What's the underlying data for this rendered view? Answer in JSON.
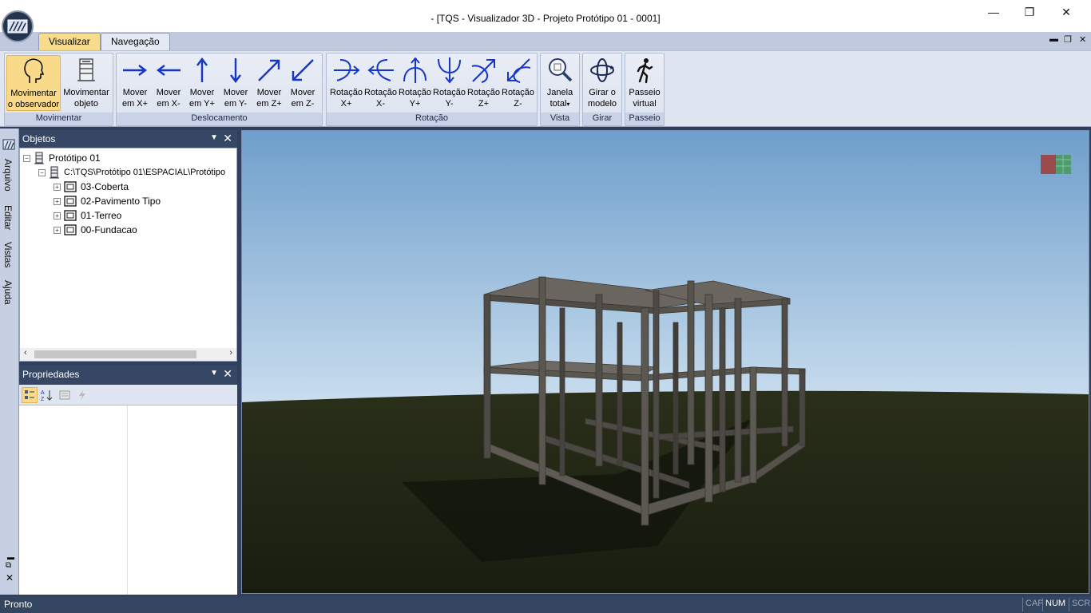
{
  "window": {
    "title": "- [TQS - Visualizador 3D - Projeto Protótipo 01 - 0001]",
    "minimize": "—",
    "maximize": "❐",
    "close": "✕"
  },
  "tabs": [
    {
      "label": "Visualizar",
      "active": true
    },
    {
      "label": "Navegação",
      "active": false
    }
  ],
  "mdi_controls": {
    "minimize": "▬",
    "restore": "❐",
    "close": "✕"
  },
  "ribbon": {
    "groups": [
      {
        "label": "Movimentar"
      },
      {
        "label": "Deslocamento"
      },
      {
        "label": "Rotação"
      },
      {
        "label": "Vista"
      },
      {
        "label": "Girar"
      },
      {
        "label": "Passeio"
      }
    ],
    "buttons": {
      "movimentar_observador": {
        "line1": "Movimentar",
        "line2": "o observador",
        "icon": "head-icon"
      },
      "movimentar_objeto": {
        "line1": "Movimentar",
        "line2": "objeto",
        "icon": "building-icon"
      },
      "mover_x_pos": {
        "line1": "Mover",
        "line2": "em X+",
        "icon": "arrow-right-icon"
      },
      "mover_x_neg": {
        "line1": "Mover",
        "line2": "em X-",
        "icon": "arrow-left-icon"
      },
      "mover_y_pos": {
        "line1": "Mover",
        "line2": "em Y+",
        "icon": "arrow-up-icon"
      },
      "mover_y_neg": {
        "line1": "Mover",
        "line2": "em Y-",
        "icon": "arrow-down-icon"
      },
      "mover_z_pos": {
        "line1": "Mover",
        "line2": "em Z+",
        "icon": "arrow-diagonal-up-icon"
      },
      "mover_z_neg": {
        "line1": "Mover",
        "line2": "em Z-",
        "icon": "arrow-diagonal-down-icon"
      },
      "rot_x_pos": {
        "line1": "Rotação",
        "line2": "X+",
        "icon": "rotate-x-pos-icon"
      },
      "rot_x_neg": {
        "line1": "Rotação",
        "line2": "X-",
        "icon": "rotate-x-neg-icon"
      },
      "rot_y_pos": {
        "line1": "Rotação",
        "line2": "Y+",
        "icon": "rotate-y-pos-icon"
      },
      "rot_y_neg": {
        "line1": "Rotação",
        "line2": "Y-",
        "icon": "rotate-y-neg-icon"
      },
      "rot_z_pos": {
        "line1": "Rotação",
        "line2": "Z+",
        "icon": "rotate-z-pos-icon"
      },
      "rot_z_neg": {
        "line1": "Rotação",
        "line2": "Z-",
        "icon": "rotate-z-neg-icon"
      },
      "janela_total": {
        "line1": "Janela",
        "line2": "total",
        "icon": "magnifier-icon"
      },
      "girar_modelo": {
        "line1": "Girar o",
        "line2": "modelo",
        "icon": "orbit-icon"
      },
      "passeio_virtual": {
        "line1": "Passeio",
        "line2": "virtual",
        "icon": "walking-person-icon"
      }
    }
  },
  "left_strip": {
    "tabs": [
      "Arquivo",
      "Editar",
      "Vistas",
      "Ajuda"
    ]
  },
  "objetos_panel": {
    "title": "Objetos",
    "tree": [
      {
        "label": "Protótipo 01",
        "expander": "−"
      },
      {
        "label": "C:\\TQS\\Protótipo 01\\ESPACIAL\\Protótipo",
        "expander": "−"
      },
      {
        "label": "03-Coberta",
        "expander": "+"
      },
      {
        "label": "02-Pavimento Tipo",
        "expander": "+"
      },
      {
        "label": "01-Terreo",
        "expander": "+"
      },
      {
        "label": "00-Fundacao",
        "expander": "+"
      }
    ]
  },
  "propriedades_panel": {
    "title": "Propriedades"
  },
  "status": {
    "text": "Pronto",
    "indicators": [
      "CAP",
      "NUM",
      "SCRL"
    ]
  },
  "colors": {
    "sky_top": "#6f9fcb",
    "sky_bottom": "#c9ddee",
    "ground": "#1f2414",
    "concrete": "#5d5852",
    "accent_tab": "#f7dc8e",
    "panel_header": "#364766",
    "icon_blue": "#1536c8"
  }
}
